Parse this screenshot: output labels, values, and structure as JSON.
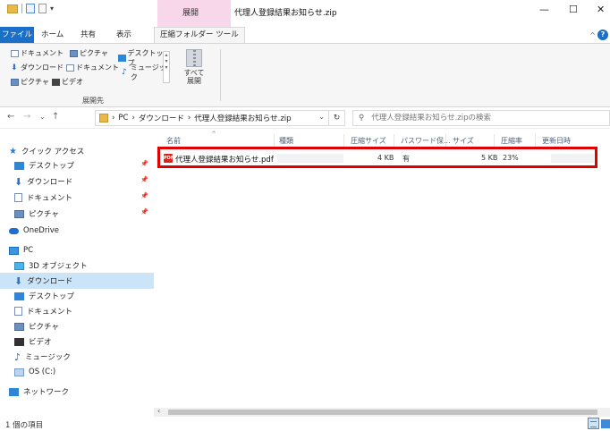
{
  "title_bar": {
    "context_tab_title": "展開",
    "window_title": "代理人登録結果お知らせ.zip",
    "controls": {
      "minimize": "—",
      "maximize": "☐",
      "close": "✕"
    }
  },
  "ribbon_tabs": {
    "file": "ファイル",
    "home": "ホーム",
    "share": "共有",
    "view": "表示",
    "compressed_tools": "圧縮フォルダー ツール",
    "collapse": "^",
    "help": "?"
  },
  "ribbon": {
    "destinations": [
      {
        "label": "ドキュメント",
        "icon": "document-icon"
      },
      {
        "label": "ピクチャ",
        "icon": "pictures-icon"
      },
      {
        "label": "デスクトップ",
        "icon": "desktop-icon"
      },
      {
        "label": "ダウンロード",
        "icon": "download-icon"
      },
      {
        "label": "ドキュメント",
        "icon": "document-icon"
      },
      {
        "label": "ミュージック",
        "icon": "music-icon"
      },
      {
        "label": "ピクチャ",
        "icon": "pictures-icon"
      },
      {
        "label": "ビデオ",
        "icon": "video-icon"
      }
    ],
    "extract_all_line1": "すべて",
    "extract_all_line2": "展開",
    "group_label": "展開先"
  },
  "address": {
    "path": [
      "PC",
      "ダウンロード",
      "代理人登録結果お知らせ.zip"
    ],
    "separator": "›",
    "dropdown": "⌄",
    "refresh": "↻",
    "search_placeholder": "代理人登録結果お知らせ.zipの検索"
  },
  "sidebar": {
    "quick_access": {
      "label": "クイック アクセス",
      "icon": "star-icon"
    },
    "pinned": [
      {
        "label": "デスクトップ",
        "icon": "desktop-icon"
      },
      {
        "label": "ダウンロード",
        "icon": "download-icon"
      },
      {
        "label": "ドキュメント",
        "icon": "document-icon"
      },
      {
        "label": "ピクチャ",
        "icon": "pictures-icon"
      }
    ],
    "onedrive": {
      "label": "OneDrive",
      "icon": "cloud-icon"
    },
    "pc": {
      "label": "PC",
      "icon": "pc-icon"
    },
    "pc_items": [
      {
        "label": "3D オブジェクト",
        "icon": "3d-objects-icon"
      },
      {
        "label": "ダウンロード",
        "icon": "download-icon",
        "selected": true
      },
      {
        "label": "デスクトップ",
        "icon": "desktop-icon"
      },
      {
        "label": "ドキュメント",
        "icon": "document-icon"
      },
      {
        "label": "ピクチャ",
        "icon": "pictures-icon"
      },
      {
        "label": "ビデオ",
        "icon": "video-icon"
      },
      {
        "label": "ミュージック",
        "icon": "music-icon"
      },
      {
        "label": "OS (C:)",
        "icon": "drive-icon"
      }
    ],
    "network": {
      "label": "ネットワーク",
      "icon": "network-icon"
    }
  },
  "file_list": {
    "columns": [
      "名前",
      "種類",
      "圧縮サイズ",
      "パスワード保...",
      "サイズ",
      "圧縮率",
      "更新日時"
    ],
    "sort_indicator": "^",
    "rows": [
      {
        "name": "代理人登録結果お知らせ.pdf",
        "icon": "pdf-icon",
        "icon_text": "PDF",
        "compressed_size": "4 KB",
        "password_protected": "有",
        "size": "5 KB",
        "ratio": "23%"
      }
    ],
    "highlight_color": "#e00000"
  },
  "status_bar": {
    "item_count": "1 個の項目"
  },
  "colors": {
    "file_tab": "#1a6fc9",
    "context_tab": "#f9d7ea",
    "selection": "#cce4f7",
    "pdf_icon": "#d9261c"
  }
}
